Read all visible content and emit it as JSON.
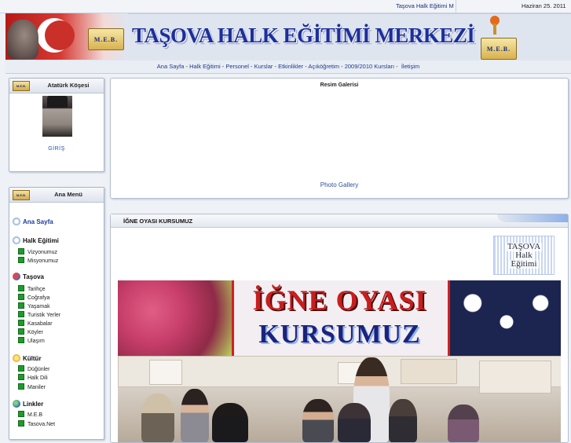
{
  "topbar": {
    "ticker": "Taşova Halk Eğitimi M",
    "date": "Haziran 25. 2011"
  },
  "banner": {
    "title": "TAŞOVA HALK EĞİTİMİ MERKEZİ",
    "logo_text": "M.E.B."
  },
  "nav": {
    "items": [
      "Ana Sayfa",
      "Halk Eğitimi",
      "Personel",
      "Kurslar",
      "Etkinlikler",
      "Açıköğretim",
      "2009/2010 Kursları",
      "İletişim"
    ]
  },
  "sidebar": {
    "ataturk": {
      "title": "Atatürk Köşesi",
      "link": "GİRİŞ"
    },
    "menu": {
      "title": "Ana Menü",
      "home": "Ana Sayfa",
      "sections": [
        {
          "title": "Halk Eğitimi",
          "icon": "home-icon",
          "items": [
            "Vizyonumuz",
            "Misyonumuz"
          ]
        },
        {
          "title": "Taşova",
          "icon": "people-icon",
          "items": [
            "Tarihçe",
            "Coğrafya",
            "Yaşamak",
            "Turistik Yerler",
            "Kasabalar",
            "Köyler",
            "Ulaşım"
          ]
        },
        {
          "title": "Kültür",
          "icon": "star-icon",
          "items": [
            "Düğünler",
            "Halk Dili",
            "Maniler"
          ]
        },
        {
          "title": "Linkler",
          "icon": "globe-icon",
          "items": [
            "M.E.B",
            "Tasova.Net"
          ]
        }
      ]
    }
  },
  "gallery": {
    "title": "Resim Galerisi",
    "link": "Photo Gallery"
  },
  "article": {
    "title": "İĞNE OYASI KURSUMUZ",
    "stamp": [
      "TAŞOVA",
      "Halk",
      "Eğitimi"
    ],
    "hero_line1": "İĞNE OYASI",
    "hero_line2": "KURSUMUZ"
  },
  "colors": {
    "link": "#2c4fa2",
    "title_blue": "#1b2f9c",
    "accent_red": "#c81e1e"
  }
}
